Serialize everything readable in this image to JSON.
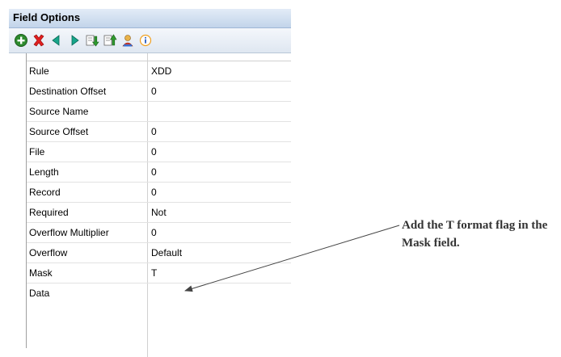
{
  "panel": {
    "title": "Field Options",
    "toolbar": [
      {
        "icon": "add-icon"
      },
      {
        "icon": "delete-icon"
      },
      {
        "icon": "move-left-icon"
      },
      {
        "icon": "move-right-icon"
      },
      {
        "icon": "move-down-icon"
      },
      {
        "icon": "move-up-icon"
      },
      {
        "icon": "person-icon"
      },
      {
        "icon": "info-icon"
      }
    ],
    "rows": [
      {
        "key": "Rule",
        "value": "XDD"
      },
      {
        "key": "Destination Offset",
        "value": "0"
      },
      {
        "key": "Source Name",
        "value": ""
      },
      {
        "key": "Source Offset",
        "value": "0"
      },
      {
        "key": "File",
        "value": "0"
      },
      {
        "key": "Length",
        "value": "0"
      },
      {
        "key": "Record",
        "value": "0"
      },
      {
        "key": "Required",
        "value": "Not"
      },
      {
        "key": "Overflow Multiplier",
        "value": "0"
      },
      {
        "key": "Overflow",
        "value": "Default"
      },
      {
        "key": "Mask",
        "value": "T"
      },
      {
        "key": "Data",
        "value": ""
      }
    ]
  },
  "callout": {
    "line1": "Add the T format flag in the",
    "line2": "Mask field."
  },
  "colors": {
    "title_gradient_top": "#e3ecf7",
    "title_gradient_bottom": "#c2d4ea"
  }
}
